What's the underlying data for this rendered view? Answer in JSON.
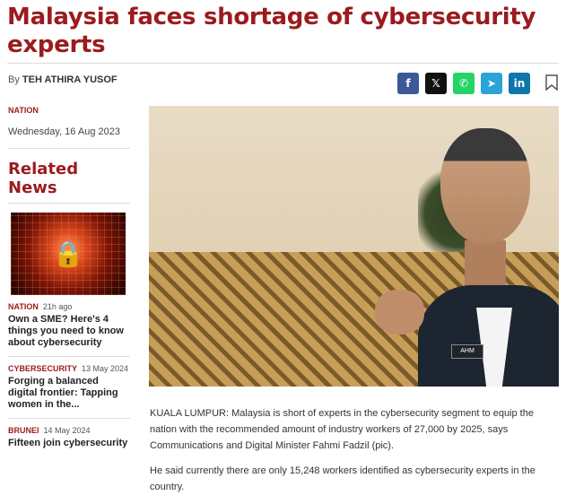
{
  "article": {
    "title": "Malaysia faces shortage of cybersecurity experts",
    "by_prefix": "By",
    "author": "TEH ATHIRA YUSOF",
    "category": "NATION",
    "date": "Wednesday, 16 Aug 2023",
    "paragraphs": [
      "KUALA LUMPUR: Malaysia is short of experts in the cybersecurity segment to equip the nation with the recommended amount of industry workers of 27,000 by 2025, says Communications and Digital Minister Fahmi Fadzil (pic).",
      "He said currently there are only 15,248 workers identified as cybersecurity experts in the country."
    ],
    "photo_badge": "AHM"
  },
  "share": {
    "facebook": "f",
    "x": "𝕏",
    "whatsapp": "✆",
    "telegram": "➤",
    "linkedin": "in",
    "colors": {
      "facebook": "#3b5998",
      "x": "#111111",
      "whatsapp": "#25d366",
      "telegram": "#2aa3d8",
      "linkedin": "#0e76a8"
    }
  },
  "related": {
    "heading": "Related News",
    "items": [
      {
        "category": "NATION",
        "ago": "21h ago",
        "title": "Own a SME? Here's 4 things you need to know about cybersecurity"
      },
      {
        "category": "CYBERSECURITY",
        "ago": "13 May 2024",
        "title": "Forging a balanced digital frontier: Tapping women in the..."
      },
      {
        "category": "BRUNEI",
        "ago": "14 May 2024",
        "title": "Fifteen join cybersecurity"
      }
    ]
  },
  "colors": {
    "accent": "#9b1b1e"
  }
}
